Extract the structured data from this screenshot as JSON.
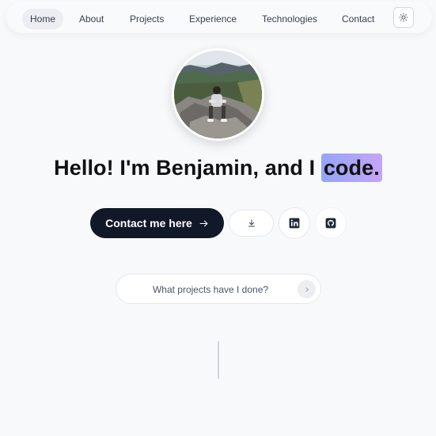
{
  "nav": {
    "items": [
      {
        "label": "Home",
        "active": true
      },
      {
        "label": "About"
      },
      {
        "label": "Projects"
      },
      {
        "label": "Experience"
      },
      {
        "label": "Technologies"
      },
      {
        "label": "Contact"
      }
    ],
    "theme_icon": "sun-icon"
  },
  "hero": {
    "headline_prefix": "Hello! I'm Benjamin, and I ",
    "headline_highlight": "code.",
    "highlight_colors": [
      "#93a5f7",
      "#c4a5f8"
    ]
  },
  "actions": {
    "contact_label": "Contact me here",
    "contact_icon": "arrow-right-icon",
    "download_icon": "download-icon",
    "linkedin_icon": "linkedin-icon",
    "github_icon": "github-icon"
  },
  "ask": {
    "placeholder": "What projects have I done?",
    "send_icon": "chevron-right-icon"
  },
  "colors": {
    "background": "#f8f9fb",
    "primary_button": "#111827"
  }
}
